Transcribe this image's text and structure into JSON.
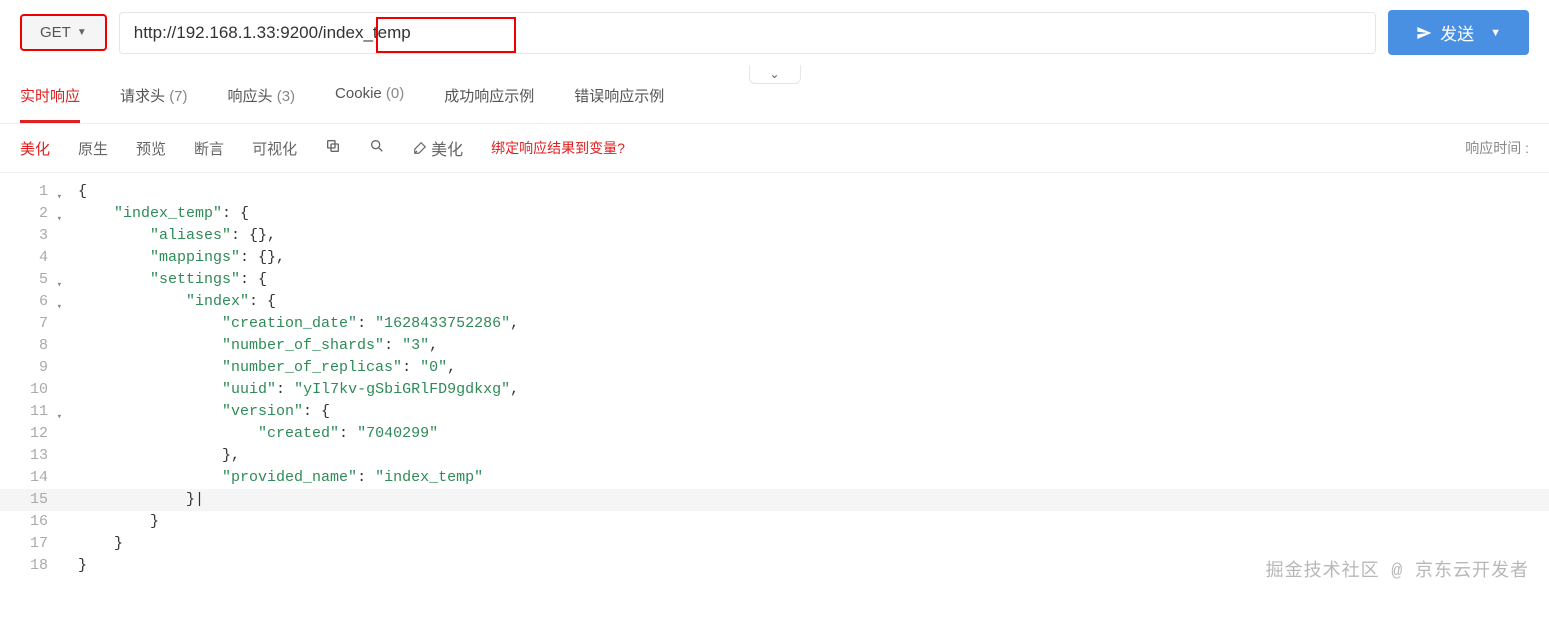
{
  "request": {
    "method": "GET",
    "url": "http://192.168.1.33:9200/index_temp",
    "url_highlight": "/index_temp",
    "send_label": "发送"
  },
  "tabs": [
    {
      "label": "实时响应",
      "count": ""
    },
    {
      "label": "请求头",
      "count": "(7)"
    },
    {
      "label": "响应头",
      "count": "(3)"
    },
    {
      "label": "Cookie",
      "count": "(0)"
    },
    {
      "label": "成功响应示例",
      "count": ""
    },
    {
      "label": "错误响应示例",
      "count": ""
    }
  ],
  "toolbar": {
    "beautify": "美化",
    "raw": "原生",
    "preview": "预览",
    "assert": "断言",
    "visualize": "可视化",
    "beautify_action": "美化",
    "bind_var": "绑定响应结果到变量?",
    "timing_label": "响应时间 :"
  },
  "code": {
    "lines": [
      {
        "n": 1,
        "fold": true,
        "indent": 0,
        "tokens": [
          [
            "punc",
            "{"
          ]
        ]
      },
      {
        "n": 2,
        "fold": true,
        "indent": 1,
        "tokens": [
          [
            "key",
            "\"index_temp\""
          ],
          [
            "punc",
            ": {"
          ]
        ]
      },
      {
        "n": 3,
        "fold": false,
        "indent": 2,
        "tokens": [
          [
            "key",
            "\"aliases\""
          ],
          [
            "punc",
            ": {},"
          ]
        ]
      },
      {
        "n": 4,
        "fold": false,
        "indent": 2,
        "tokens": [
          [
            "key",
            "\"mappings\""
          ],
          [
            "punc",
            ": {},"
          ]
        ]
      },
      {
        "n": 5,
        "fold": true,
        "indent": 2,
        "tokens": [
          [
            "key",
            "\"settings\""
          ],
          [
            "punc",
            ": {"
          ]
        ]
      },
      {
        "n": 6,
        "fold": true,
        "indent": 3,
        "tokens": [
          [
            "key",
            "\"index\""
          ],
          [
            "punc",
            ": {"
          ]
        ]
      },
      {
        "n": 7,
        "fold": false,
        "indent": 4,
        "tokens": [
          [
            "key",
            "\"creation_date\""
          ],
          [
            "punc",
            ": "
          ],
          [
            "str",
            "\"1628433752286\""
          ],
          [
            "punc",
            ","
          ]
        ]
      },
      {
        "n": 8,
        "fold": false,
        "indent": 4,
        "tokens": [
          [
            "key",
            "\"number_of_shards\""
          ],
          [
            "punc",
            ": "
          ],
          [
            "str",
            "\"3\""
          ],
          [
            "punc",
            ","
          ]
        ]
      },
      {
        "n": 9,
        "fold": false,
        "indent": 4,
        "tokens": [
          [
            "key",
            "\"number_of_replicas\""
          ],
          [
            "punc",
            ": "
          ],
          [
            "str",
            "\"0\""
          ],
          [
            "punc",
            ","
          ]
        ]
      },
      {
        "n": 10,
        "fold": false,
        "indent": 4,
        "tokens": [
          [
            "key",
            "\"uuid\""
          ],
          [
            "punc",
            ": "
          ],
          [
            "str",
            "\"yIl7kv-gSbiGRlFD9gdkxg\""
          ],
          [
            "punc",
            ","
          ]
        ]
      },
      {
        "n": 11,
        "fold": true,
        "indent": 4,
        "tokens": [
          [
            "key",
            "\"version\""
          ],
          [
            "punc",
            ": {"
          ]
        ]
      },
      {
        "n": 12,
        "fold": false,
        "indent": 5,
        "tokens": [
          [
            "key",
            "\"created\""
          ],
          [
            "punc",
            ": "
          ],
          [
            "str",
            "\"7040299\""
          ]
        ]
      },
      {
        "n": 13,
        "fold": false,
        "indent": 4,
        "tokens": [
          [
            "punc",
            "},"
          ]
        ]
      },
      {
        "n": 14,
        "fold": false,
        "indent": 4,
        "tokens": [
          [
            "key",
            "\"provided_name\""
          ],
          [
            "punc",
            ": "
          ],
          [
            "str",
            "\"index_temp\""
          ]
        ]
      },
      {
        "n": 15,
        "fold": false,
        "indent": 3,
        "tokens": [
          [
            "punc",
            "}"
          ],
          [
            "cursor",
            "|"
          ]
        ]
      },
      {
        "n": 16,
        "fold": false,
        "indent": 2,
        "tokens": [
          [
            "punc",
            "}"
          ]
        ]
      },
      {
        "n": 17,
        "fold": false,
        "indent": 1,
        "tokens": [
          [
            "punc",
            "}"
          ]
        ]
      },
      {
        "n": 18,
        "fold": false,
        "indent": 0,
        "tokens": [
          [
            "punc",
            "}"
          ]
        ]
      }
    ]
  },
  "watermark": "掘金技术社区 @ 京东云开发者",
  "watermark2": ""
}
